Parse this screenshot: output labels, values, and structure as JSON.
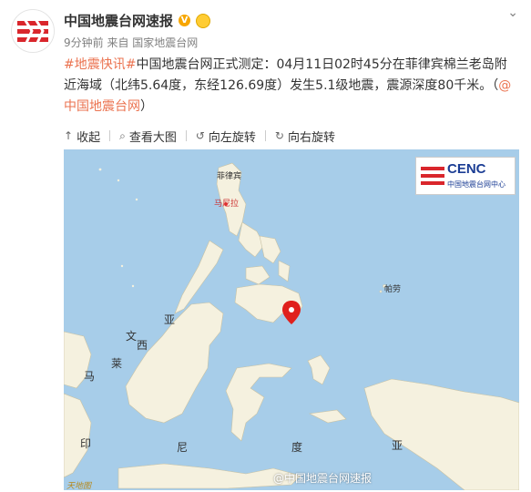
{
  "header": {
    "account_name": "中国地震台网速报",
    "meta": "9分钟前 来自 国家地震台网"
  },
  "post": {
    "hashtag": "#地震快讯#",
    "text": "中国地震台网正式测定：04月11日02时45分在菲律宾棉兰老岛附近海域（北纬5.64度，东经126.69度）发生5.1级地震，震源深度80千米。（",
    "mention": "@中国地震台网",
    "close": "）"
  },
  "toolbar": {
    "collapse": "收起",
    "view_large": "查看大图",
    "rotate_left": "向左旋转",
    "rotate_right": "向右旋转"
  },
  "map": {
    "logo_title": "CENC",
    "logo_sub": "中国地震台网中心",
    "watermark": "@中国地震台网速报",
    "credit": "天地图",
    "labels": {
      "philippines": "菲律宾",
      "manila": "马尼拉",
      "palau": "帕劳",
      "mala": "马",
      "ya": "亚",
      "wen": "文",
      "lai": "莱",
      "xi": "西",
      "ni": "尼",
      "ya2": "亚",
      "yin": "印",
      "du": "度"
    }
  }
}
